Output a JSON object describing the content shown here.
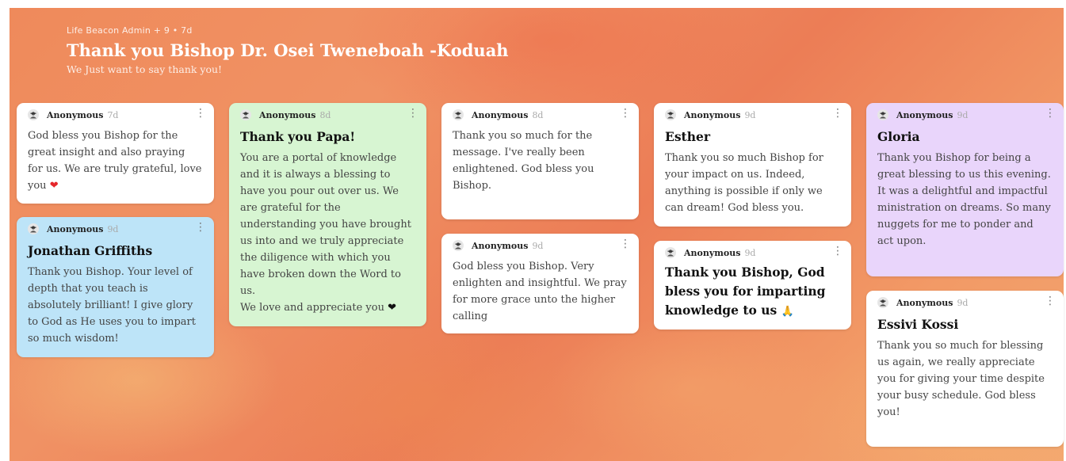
{
  "header": {
    "meta": "Life Beacon Admin + 9 • 7d",
    "title": "Thank you Bishop Dr. Osei Tweneboah -Koduah",
    "subtitle": "We Just want to say thank you!"
  },
  "colors": {
    "background": "#ef8a5b",
    "green_card": "#d7f5d2",
    "blue_card": "#bde4f8",
    "purple_card": "#e9d5fb",
    "white_card": "#ffffff"
  },
  "cards": [
    {
      "author": "Anonymous",
      "age": "7d",
      "subject": "",
      "body": "God bless you Bishop for the great insight and also praying for us. We are truly grateful, love you",
      "emoji": "❤"
    },
    {
      "author": "Anonymous",
      "age": "9d",
      "subject": "Jonathan Griffiths",
      "body": "Thank you Bishop. Your level of depth that you teach is absolutely brilliant! I give glory to God as He uses you to impart so much wisdom!"
    },
    {
      "author": "Anonymous",
      "age": "8d",
      "subject": "Thank you Papa!",
      "body": "You are a portal of knowledge and it is always a blessing to have you pour out over us. We are grateful for the understanding you have brought us into and we truly appreciate the diligence with which you have broken down the Word to us.",
      "body2": "We love and appreciate you",
      "emoji": "❤"
    },
    {
      "author": "Anonymous",
      "age": "8d",
      "subject": "",
      "body": "Thank you so much for the message. I've really been enlightened. God bless you Bishop."
    },
    {
      "author": "Anonymous",
      "age": "9d",
      "subject": "",
      "body": "God bless you Bishop. Very enlighten and insightful. We pray for more grace unto the higher calling"
    },
    {
      "author": "Anonymous",
      "age": "9d",
      "subject": "Esther",
      "body": "Thank you so much Bishop for your impact on us. Indeed, anything is possible if only we can dream! God bless you."
    },
    {
      "author": "Anonymous",
      "age": "9d",
      "subject": "Thank you Bishop, God bless you for imparting knowledge to us",
      "emoji": "🙏"
    },
    {
      "author": "Anonymous",
      "age": "9d",
      "subject": "Gloria",
      "body": "Thank you Bishop for being a great blessing to us this evening. It was a delightful and impactful ministration on dreams. So many nuggets for me to ponder and act upon."
    },
    {
      "author": "Anonymous",
      "age": "9d",
      "subject": "Essivi Kossi",
      "body": "Thank you so much for blessing us again, we really appreciate you for giving your time despite your busy schedule. God bless you!"
    }
  ],
  "icons": {
    "avatar": "anonymous-avatar-icon",
    "more": "more-vertical-icon"
  }
}
